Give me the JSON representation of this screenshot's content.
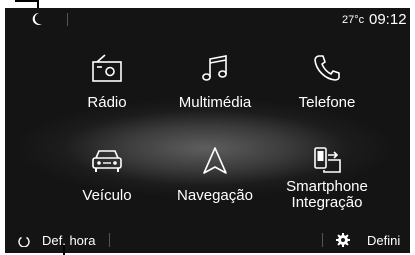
{
  "status_bar": {
    "temperature": "27°c",
    "time": "09:12",
    "night_mode_icon": "moon-icon"
  },
  "menu": [
    {
      "label": "Rádio",
      "icon": "radio-icon"
    },
    {
      "label": "Multimédia",
      "icon": "music-note-icon"
    },
    {
      "label": "Telefone",
      "icon": "phone-icon"
    },
    {
      "label": "Veículo",
      "icon": "car-icon"
    },
    {
      "label": "Navegação",
      "icon": "navigation-arrow-icon"
    },
    {
      "label_line1": "Smartphone",
      "label_line2": "Integração",
      "icon": "smartphone-projection-icon"
    }
  ],
  "bottom_bar": {
    "left_label": "Def. hora",
    "right_label": "Defini",
    "left_icon": "power-icon",
    "right_icon": "gear-icon"
  },
  "colors": {
    "text": "#ffffff",
    "background": "#1a1a1a"
  }
}
